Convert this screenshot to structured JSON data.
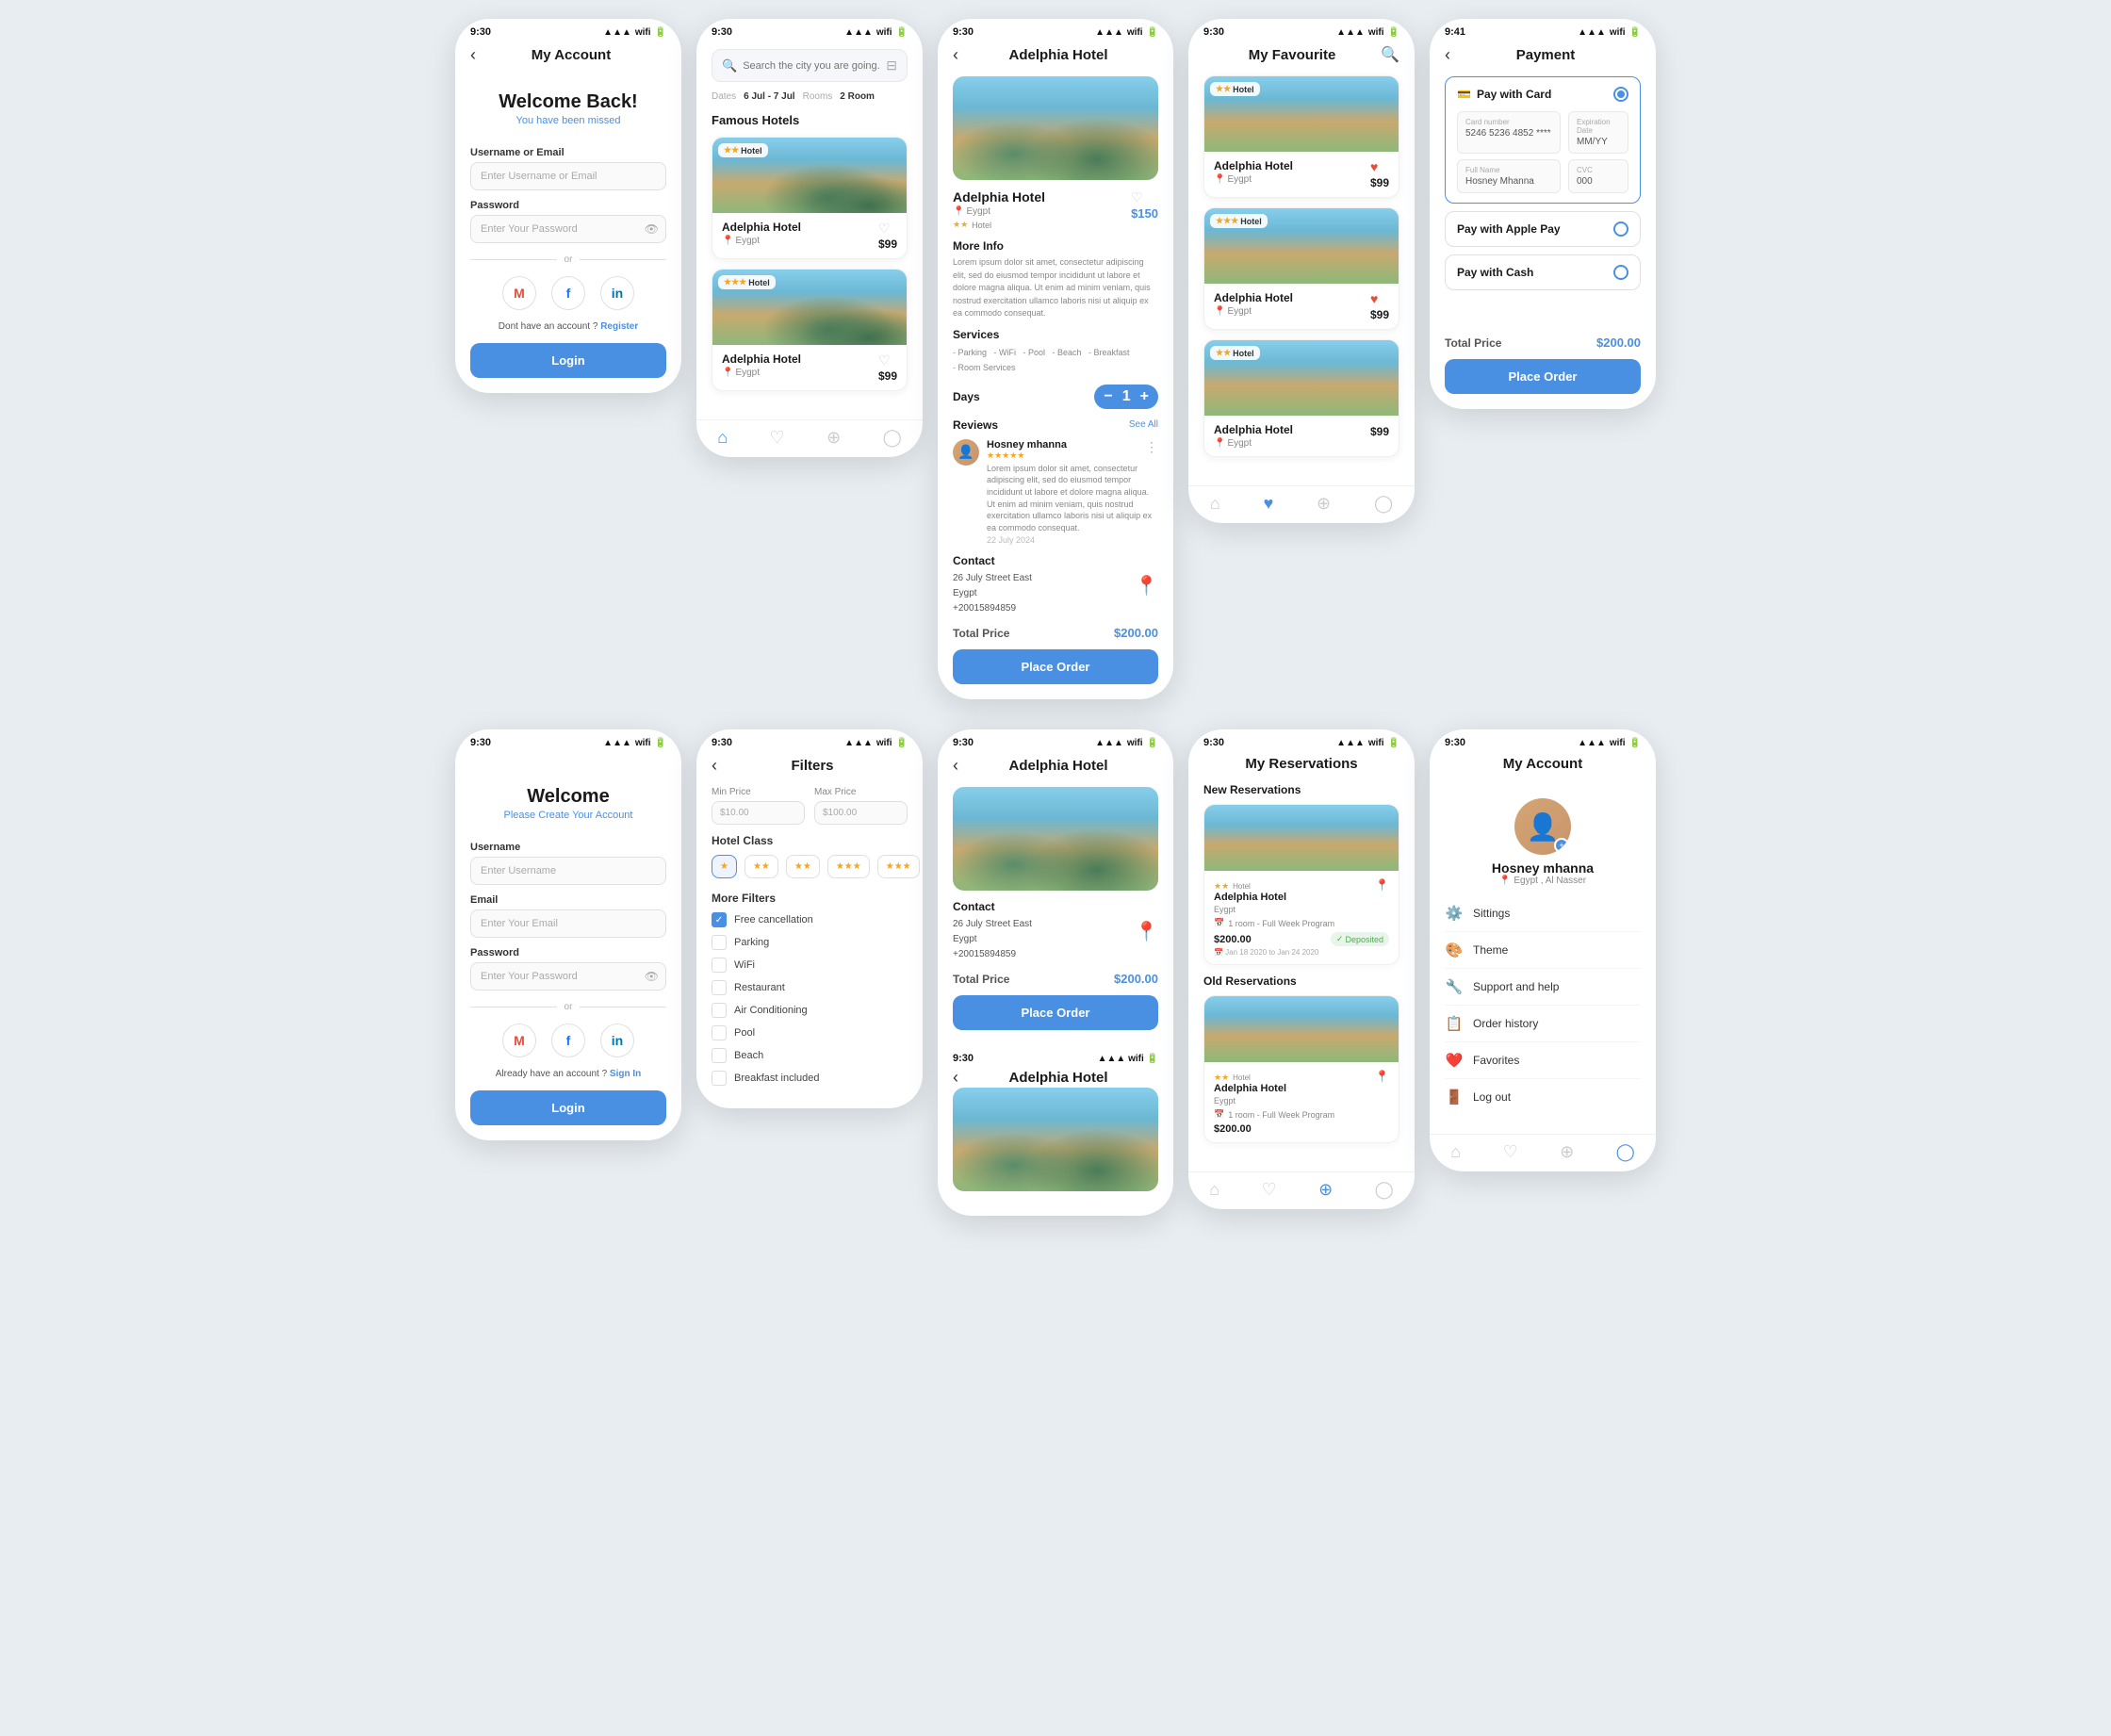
{
  "screens": {
    "login_existing": {
      "status_time": "9:30",
      "title": "My Account",
      "welcome": "Welcome Back!",
      "welcome_sub": "You have been missed",
      "username_label": "Username or Email",
      "username_placeholder": "Enter Username or Email",
      "password_label": "Password",
      "password_placeholder": "Enter Your Password",
      "or_text": "or",
      "no_account": "Dont have an account ?",
      "register_link": "Register",
      "login_btn": "Login"
    },
    "login_new": {
      "status_time": "9:30",
      "welcome": "Welcome",
      "welcome_sub": "Please Create Your Account",
      "username_label": "Username",
      "username_placeholder": "Enter Username",
      "email_label": "Email",
      "email_placeholder": "Enter Your Email",
      "password_label": "Password",
      "password_placeholder": "Enter Your Password",
      "or_text": "or",
      "have_account": "Already have an account ?",
      "signin_link": "Sign In",
      "login_btn": "Login"
    },
    "search": {
      "status_time": "9:30",
      "search_placeholder": "Search the city you are going...",
      "dates_label": "Dates",
      "dates_value": "6 Jul - 7 Jul",
      "rooms_label": "Rooms",
      "rooms_value": "2 Room",
      "section_title": "Famous Hotels",
      "hotels": [
        {
          "name": "Adelphia Hotel",
          "location": "Eygpt",
          "price": "$99",
          "stars": "★★",
          "badge": "Hotel"
        },
        {
          "name": "Adelphia Hotel",
          "location": "Eygpt",
          "price": "$99",
          "stars": "★★★",
          "badge": "Hotel"
        }
      ]
    },
    "filters": {
      "status_time": "9:30",
      "title": "Filters",
      "min_price_label": "Min Price",
      "min_price_value": "$10.00",
      "max_price_label": "Max Price",
      "max_price_value": "$100.00",
      "hotel_class_label": "Hotel Class",
      "star_options": [
        "★",
        "★★",
        "★★",
        "★★★",
        "★★★"
      ],
      "more_filters_label": "More Filters",
      "filters": [
        {
          "label": "Free cancellation",
          "checked": true
        },
        {
          "label": "Parking",
          "checked": false
        },
        {
          "label": "WiFi",
          "checked": false
        },
        {
          "label": "Restaurant",
          "checked": false
        },
        {
          "label": "Air Conditioning",
          "checked": false
        },
        {
          "label": "Pool",
          "checked": false
        },
        {
          "label": "Beach",
          "checked": false
        },
        {
          "label": "Breakfast included",
          "checked": false
        }
      ]
    },
    "hotel_detail_top": {
      "status_time": "9:30",
      "title": "Adelphia Hotel",
      "hotel_name": "Adelphia Hotel",
      "location": "Eygpt",
      "stars": "★★",
      "badge": "Hotel",
      "price": "$150",
      "more_info_title": "More Info",
      "more_info_text": "Lorem ipsum dolor sit amet, consectetur adipiscing elit, sed do eiusmod tempor incididunt ut labore et dolore magna aliqua. Ut enim ad minim veniam, quis nostrud exercitation ullamco laboris nisi ut aliquip ex ea commodo consequat.",
      "services_title": "Services",
      "services": "- Parking  - WiFi  - Pool  - Beach  - Breakfast\n- Room Services",
      "days_label": "Days",
      "days_count": "1",
      "reviews_title": "Reviews",
      "see_all": "See All",
      "reviewer": {
        "name": "Hosney mhanna",
        "stars": "★★★★★",
        "text": "Lorem ipsum dolor sit amet, consectetur adipiscing elit, sed do eiusmod tempor incididunt ut labore et dolore magna aliqua. Ut enim ad minim veniam, quis nostrud exercitation ullamco laboris nisi ut aliquip ex ea commodo consequat.",
        "date": "22 July 2024"
      },
      "contact_title": "Contact",
      "contact_address": "26 July Street East",
      "contact_country": "Eygpt",
      "contact_phone": "+20015894859",
      "total_label": "Total Price",
      "total_amount": "$200.00",
      "place_order_btn": "Place Order"
    },
    "hotel_detail_bottom": {
      "status_time": "9:30",
      "title": "Adelphia Hotel"
    },
    "my_favourite": {
      "status_time": "9:30",
      "title": "My Favourite",
      "hotels": [
        {
          "name": "Adelphia Hotel",
          "location": "Eygpt",
          "price": "$99",
          "stars": "★★",
          "badge": "Hotel",
          "favorited": true
        },
        {
          "name": "Adelphia Hotel",
          "location": "Eygpt",
          "price": "$99",
          "stars": "★★★",
          "badge": "Hotel",
          "favorited": true
        },
        {
          "name": "Adelphia Hotel",
          "location": "Eygpt",
          "price": "$99",
          "stars": "★★",
          "badge": "Hotel",
          "favorited": false
        }
      ]
    },
    "my_reservations": {
      "status_time": "9:30",
      "title": "My Reservations",
      "new_section": "New Reservations",
      "old_section": "Old Reservations",
      "new_reservations": [
        {
          "hotel_name": "Adelphia Hotel",
          "location": "Eygpt",
          "stars": "★★",
          "badge": "Hotel",
          "program": "1 room - Full Week Program",
          "price": "$200.00",
          "dates": "Jan 18 2020 to Jan 24 2020",
          "status": "Deposited"
        }
      ],
      "old_reservations": [
        {
          "hotel_name": "Adelphia Hotel",
          "location": "Eygpt",
          "stars": "★★",
          "badge": "Hotel",
          "program": "1 room - Full Week Program",
          "price": "$200.00"
        }
      ]
    },
    "payment": {
      "status_time": "9:41",
      "title": "Payment",
      "pay_with_card_label": "Pay with Card",
      "card_number_label": "Card number",
      "card_number_value": "5246 5236 4852 ****",
      "exp_label": "Expiration Date",
      "exp_value": "MM/YY",
      "full_name_label": "Full Name",
      "full_name_value": "Hosney Mhanna",
      "cvc_label": "CVC",
      "cvc_value": "000",
      "pay_apple_label": "Pay with Apple Pay",
      "pay_cash_label": "Pay with Cash",
      "total_label": "Total Price",
      "total_amount": "$200.00",
      "place_order_btn": "Place Order"
    },
    "my_account": {
      "status_time": "9:30",
      "title": "My Account",
      "user_name": "Hosney mhanna",
      "user_location": "Egypt , Al Nasser",
      "menu_items": [
        {
          "icon": "⚙️",
          "label": "Sittings"
        },
        {
          "icon": "🎨",
          "label": "Theme"
        },
        {
          "icon": "🔧",
          "label": "Support and help"
        },
        {
          "icon": "📋",
          "label": "Order history"
        },
        {
          "icon": "❤️",
          "label": "Favorites"
        },
        {
          "icon": "🚪",
          "label": "Log out"
        }
      ]
    }
  },
  "icons": {
    "back": "‹",
    "search": "🔍",
    "filter": "⊟",
    "location_pin": "📍",
    "heart": "♡",
    "heart_filled": "♥",
    "home": "⌂",
    "bookmark": "⊕",
    "person": "◯",
    "map_pin": "◎",
    "credit_card": "💳",
    "search_circle": "○",
    "plus_icon": "+",
    "eye": "👁",
    "more_vert": "⋮",
    "check": "✓",
    "location_dot": "•"
  },
  "colors": {
    "primary": "#4a90e2",
    "danger": "#e74c3c",
    "success": "#4caf50",
    "text_dark": "#1a1a1a",
    "text_muted": "#888",
    "border": "#e0e0e0",
    "bg_light": "#fafafa"
  }
}
